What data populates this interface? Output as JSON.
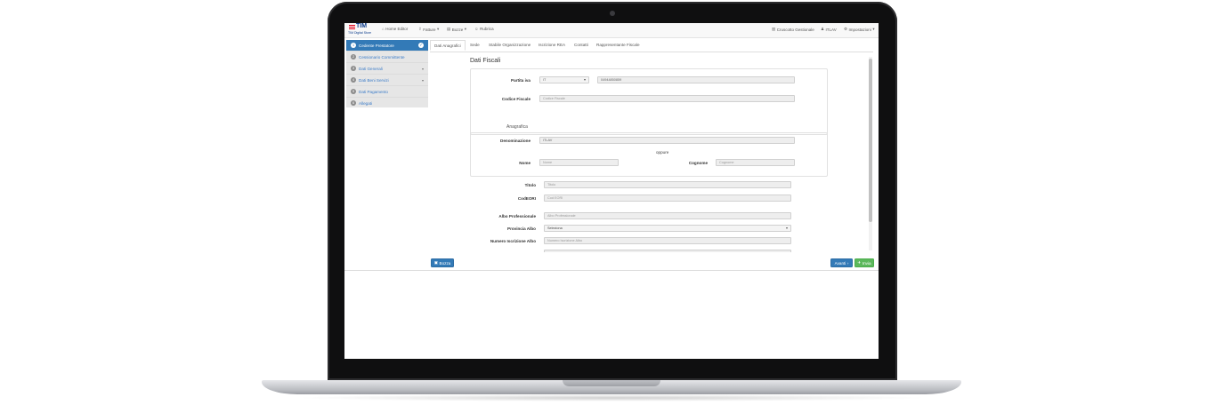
{
  "navbar": {
    "logo_text": "TIM",
    "logo_sub": "TIM Digital Store",
    "items": [
      {
        "label": "Home Editor",
        "icon": "home-icon",
        "glyph": "⌂"
      },
      {
        "label": "Fatture",
        "icon": "upload-icon",
        "glyph": "⇪"
      },
      {
        "label": "Bozze",
        "icon": "drafts-icon",
        "glyph": "▤"
      },
      {
        "label": "Rubrica",
        "icon": "users-icon",
        "glyph": "☺"
      }
    ],
    "right_items": [
      {
        "label": "Cruscotto Gestionale",
        "icon": "dashboard-icon",
        "glyph": "▥"
      },
      {
        "label": "ITLAV",
        "icon": "user-icon",
        "glyph": "♟"
      },
      {
        "label": "Impostazioni",
        "icon": "gear-icon",
        "glyph": "⚙"
      }
    ]
  },
  "sidebar": {
    "steps": [
      {
        "num": "1",
        "label": "Cedente Prestatore"
      },
      {
        "num": "2",
        "label": "Cessionario Committente"
      },
      {
        "num": "3",
        "label": "Dati Generali"
      },
      {
        "num": "4",
        "label": "Dati Beni Servizi"
      },
      {
        "num": "5",
        "label": "Dati Pagamento"
      },
      {
        "num": "6",
        "label": "Allegati"
      }
    ]
  },
  "tabs": [
    "Dati Anagrafici",
    "Sede",
    "Stabile Organizzazione",
    "Iscrizione REA",
    "Contatti",
    "Rappresentante Fiscale"
  ],
  "form": {
    "section_title": "Dati Fiscali",
    "partita_iva_label": "Partita iva",
    "country_value": "IT",
    "piva_value": "04944850859",
    "codice_fiscale_label": "Codice Fiscale",
    "codice_fiscale_placeholder": "Codice Fiscale",
    "anagrafica_title": "Anagrafica",
    "denominazione_label": "Denominazione",
    "denominazione_value": "ITLAV",
    "oppure": "oppure",
    "nome_label": "Nome",
    "nome_placeholder": "Nome",
    "cognome_label": "Cognome",
    "cognome_placeholder": "Cognome",
    "titolo_label": "Titolo",
    "titolo_placeholder": "Titolo",
    "codeori_label": "CodEORI",
    "codeori_placeholder": "Cod EORI",
    "albo_label": "Albo Professionale",
    "albo_placeholder": "Albo Professionale",
    "provincia_label": "Provincia Albo",
    "provincia_value": "Seleziona",
    "numero_label": "Numero Iscrizione Albo",
    "numero_placeholder": "Numero Iscrizione Albo"
  },
  "footer": {
    "bozza_label": "Bozza",
    "avanti_label": "Avanti",
    "invia_label": "Invia"
  }
}
